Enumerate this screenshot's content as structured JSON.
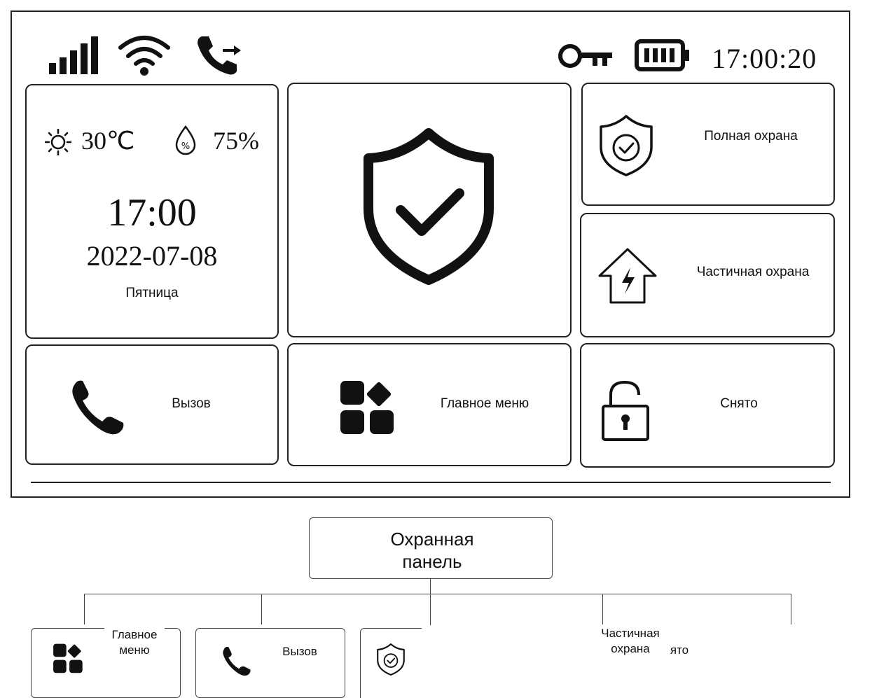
{
  "status_bar": {
    "time": "17:00:20",
    "icons": [
      "signal-bars-icon",
      "wifi-icon",
      "call-forward-icon",
      "key-icon",
      "battery-icon"
    ]
  },
  "weather": {
    "temperature": "30℃",
    "humidity": "75%",
    "icons": [
      "sun-icon",
      "humidity-drop-icon"
    ]
  },
  "clock_tile": {
    "time": "17:00",
    "date": "2022-07-08",
    "weekday": "Пятница"
  },
  "center_tile": {
    "icon": "shield-check-icon"
  },
  "tiles": {
    "full_guard": {
      "label": "Полная охрана",
      "icon": "shield-check-icon"
    },
    "partial_guard": {
      "label": "Частичная охрана",
      "icon": "house-lightning-icon"
    },
    "call": {
      "label": "Вызов",
      "icon": "phone-icon"
    },
    "main_menu": {
      "label": "Главное меню",
      "icon": "apps-grid-icon"
    },
    "disarmed": {
      "label": "Снято",
      "icon": "padlock-open-icon"
    }
  },
  "tree": {
    "root_label": "Охранная панель",
    "children": [
      {
        "label": "Главное меню",
        "icon": "apps-grid-icon"
      },
      {
        "label": "Вызов",
        "icon": "phone-icon"
      },
      {
        "label": "",
        "icon": "shield-check-icon"
      },
      {
        "label": "Частичная охрана",
        "icon": ""
      },
      {
        "label": "ято",
        "icon": ""
      }
    ]
  },
  "colors": {
    "line": "#222222",
    "background": "#ffffff"
  }
}
